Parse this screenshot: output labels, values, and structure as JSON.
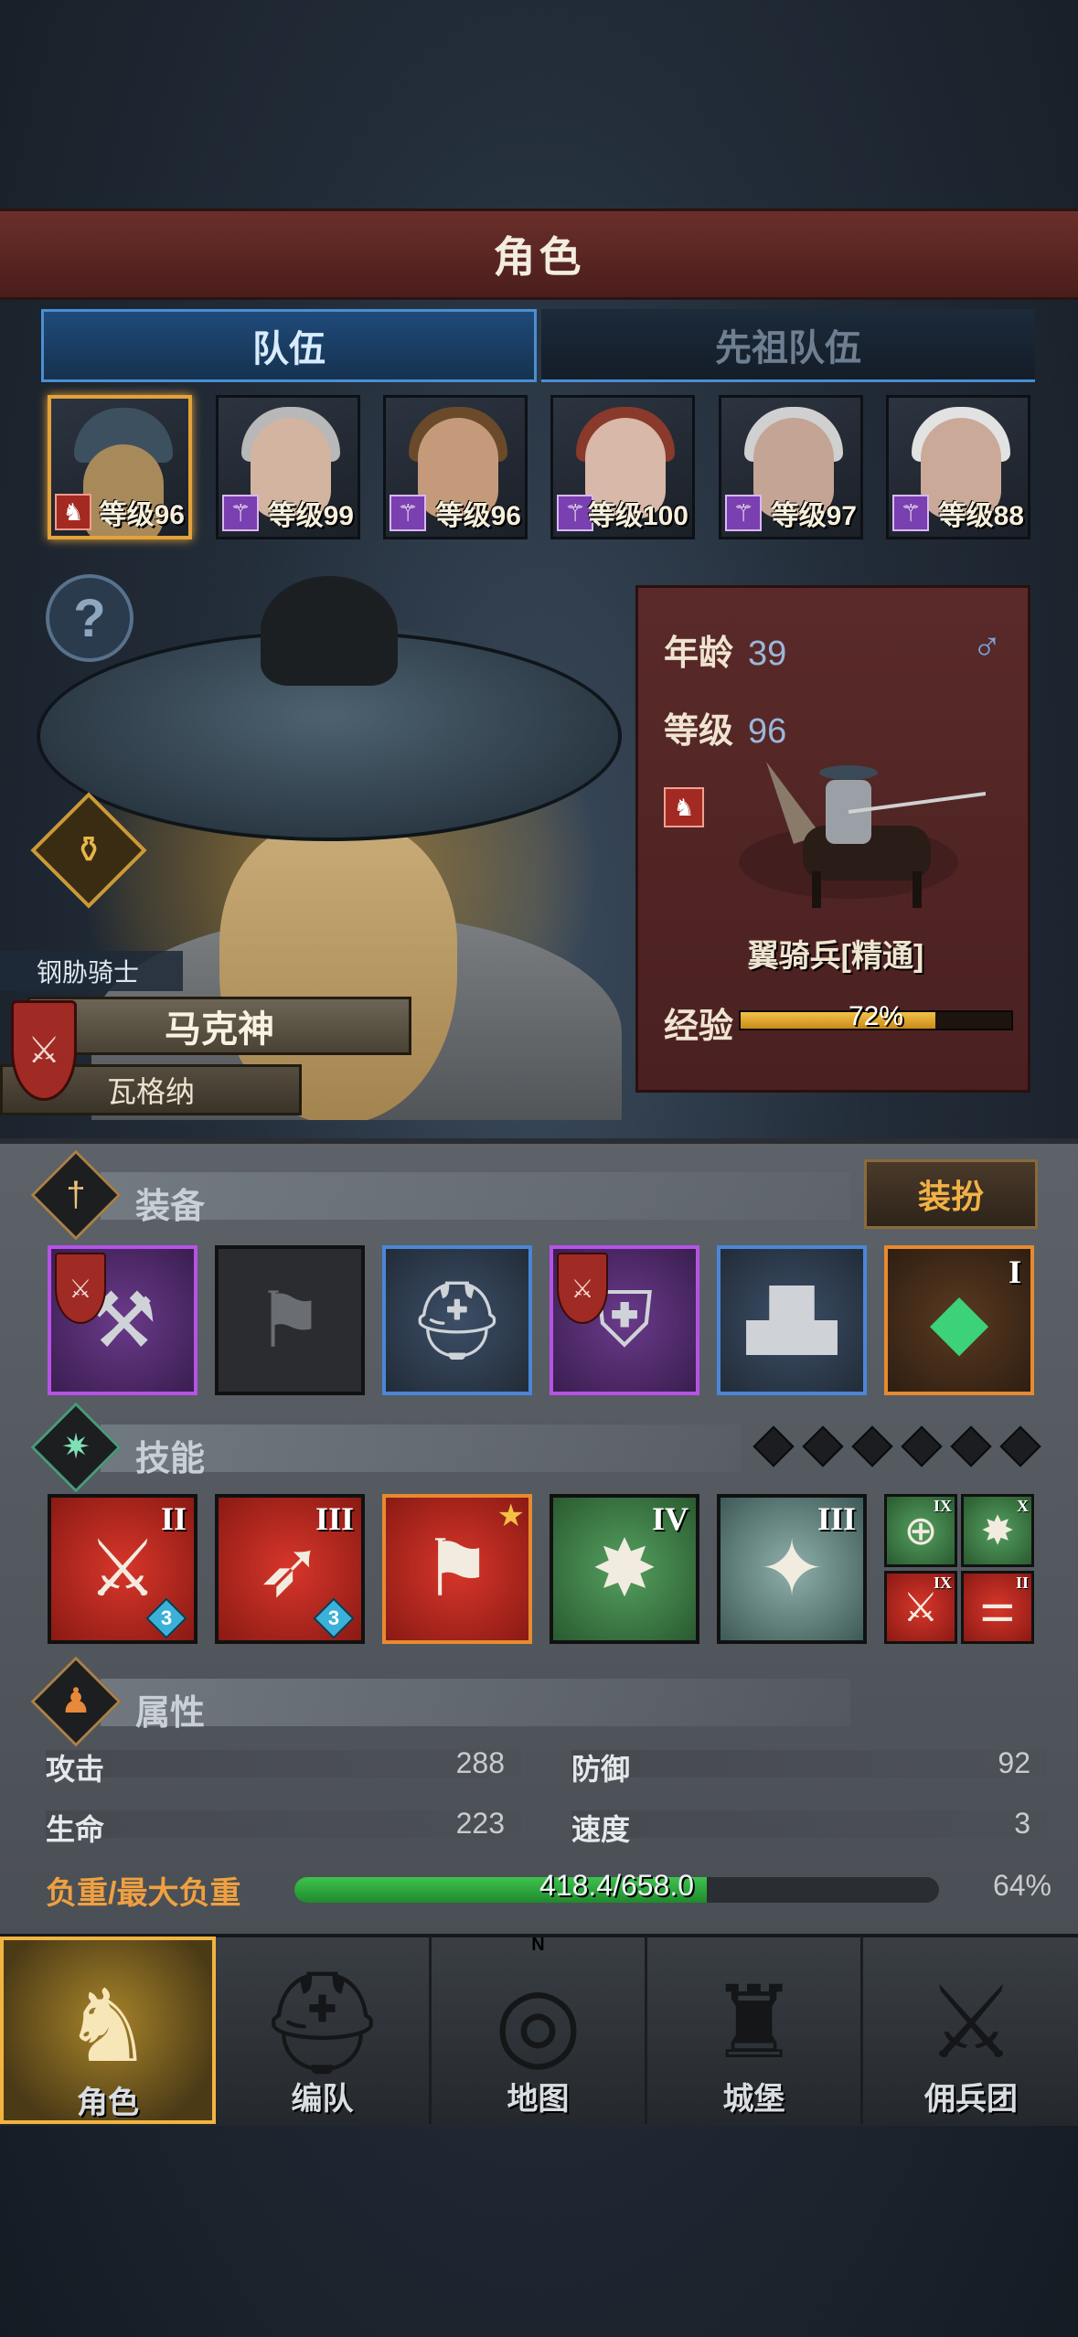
{
  "header": {
    "title": "角色"
  },
  "tabs": [
    {
      "label": "队伍",
      "active": true
    },
    {
      "label": "先祖队伍",
      "active": false
    }
  ],
  "team": [
    {
      "level_text": "等级96",
      "class_icon": "horse-icon",
      "selected": true
    },
    {
      "level_text": "等级99",
      "class_icon": "staff-icon",
      "selected": false
    },
    {
      "level_text": "等级96",
      "class_icon": "staff-icon",
      "selected": false
    },
    {
      "level_text": "等级100",
      "class_icon": "staff-icon",
      "selected": false
    },
    {
      "level_text": "等级97",
      "class_icon": "staff-icon",
      "selected": false
    },
    {
      "level_text": "等级88",
      "class_icon": "staff-icon",
      "selected": false
    }
  ],
  "hero": {
    "class_title": "钢胁骑士",
    "name": "马克神",
    "origin": "瓦格纳"
  },
  "info": {
    "age_label": "年龄",
    "age_value": "39",
    "level_label": "等级",
    "level_value": "96",
    "gender_icon": "male-icon",
    "unit_name": "翼骑兵[精通]",
    "exp_label": "经验",
    "exp_text": "72%",
    "exp_fraction": 0.72
  },
  "equipment": {
    "title": "装备",
    "dress_button": "装扮",
    "slots": [
      {
        "name": "weapon-hammer",
        "rarity": "purple",
        "glyph": "⚒",
        "shield": true,
        "roman": ""
      },
      {
        "name": "banner-slot",
        "rarity": "gray",
        "glyph": "⚑",
        "shield": false,
        "roman": ""
      },
      {
        "name": "helmet",
        "rarity": "blue",
        "glyph": "⛑",
        "shield": false,
        "roman": ""
      },
      {
        "name": "armor",
        "rarity": "purple",
        "glyph": "⛨",
        "shield": true,
        "roman": ""
      },
      {
        "name": "boots",
        "rarity": "blue",
        "glyph": "▟▙",
        "shield": false,
        "roman": ""
      },
      {
        "name": "crystal",
        "rarity": "orange",
        "glyph": "◆",
        "shield": false,
        "roman": "I"
      }
    ]
  },
  "skills": {
    "title": "技能",
    "items": [
      {
        "color": "red",
        "roman": "II",
        "glyph": "⚔",
        "gem": "3",
        "star": false,
        "orange": false
      },
      {
        "color": "red",
        "roman": "III",
        "glyph": "➶",
        "gem": "3",
        "star": false,
        "orange": false
      },
      {
        "color": "red",
        "roman": "",
        "glyph": "⚑",
        "gem": "",
        "star": true,
        "orange": true
      },
      {
        "color": "green",
        "roman": "IV",
        "glyph": "✸",
        "gem": "",
        "star": false,
        "orange": false
      },
      {
        "color": "teal",
        "roman": "III",
        "glyph": "✦",
        "gem": "",
        "star": false,
        "orange": false
      }
    ],
    "mini": [
      {
        "color": "green",
        "roman": "IX",
        "glyph": "⊕"
      },
      {
        "color": "green",
        "roman": "X",
        "glyph": "✸"
      },
      {
        "color": "red",
        "roman": "IX",
        "glyph": "⚔"
      },
      {
        "color": "red",
        "roman": "II",
        "glyph": "⚌"
      }
    ]
  },
  "attributes": {
    "title": "属性",
    "attack_label": "攻击",
    "attack_value": "288",
    "defense_label": "防御",
    "defense_value": "92",
    "hp_label": "生命",
    "hp_value": "223",
    "speed_label": "速度",
    "speed_value": "3",
    "load_label": "负重/最大负重",
    "load_text": "418.4/658.0",
    "load_pct": "64%",
    "load_fraction": 0.64
  },
  "nav": [
    {
      "label": "角色",
      "active": true
    },
    {
      "label": "编队",
      "active": false
    },
    {
      "label": "地图",
      "active": false,
      "compass": "N"
    },
    {
      "label": "城堡",
      "active": false
    },
    {
      "label": "佣兵团",
      "active": false
    }
  ],
  "colors": {
    "accent_gold": "#f2b440",
    "tab_blue": "#4b8ed2",
    "banner_red": "#6b2f2a",
    "rarity_purple": "#b653e6",
    "rarity_blue": "#4a86d8",
    "rarity_orange": "#e78a30",
    "load_green": "#3ec24e"
  }
}
